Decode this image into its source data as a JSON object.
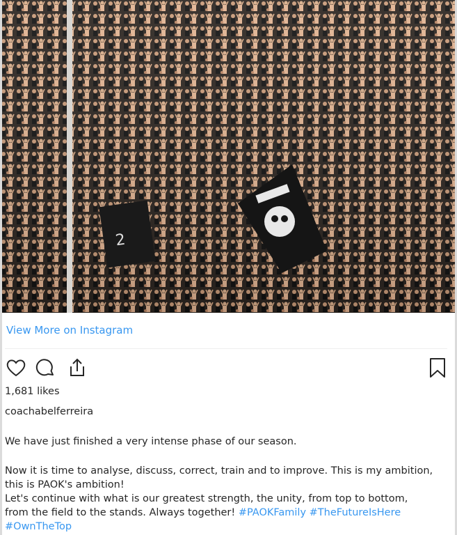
{
  "post": {
    "image_alt": "crowd-of-fans-with-paok-flags",
    "view_more_label": "View More on Instagram",
    "likes": "1,681 likes",
    "username": "coachabelferreira",
    "caption": {
      "line1": "We have just finished a very intense phase of our season.",
      "line2": "Now it is time to analyse, discuss, correct, train and to improve. This is my ambition,",
      "line3": "this is PAOK's ambition!",
      "line4": "Let's continue with what is our greatest strength, the unity, from top to bottom,",
      "line5_text": "from the field to the stands. Always together! ",
      "hashtag1": "#PAOKFamily",
      "hashtag2": "#TheFutureIsHere",
      "hashtag3": "#OwnTheTop"
    }
  },
  "colors": {
    "link_blue": "#3897f0",
    "text": "#262626",
    "icon_stroke": "#262626"
  },
  "icons": [
    "heart-icon",
    "comment-icon",
    "share-icon",
    "bookmark-icon"
  ]
}
